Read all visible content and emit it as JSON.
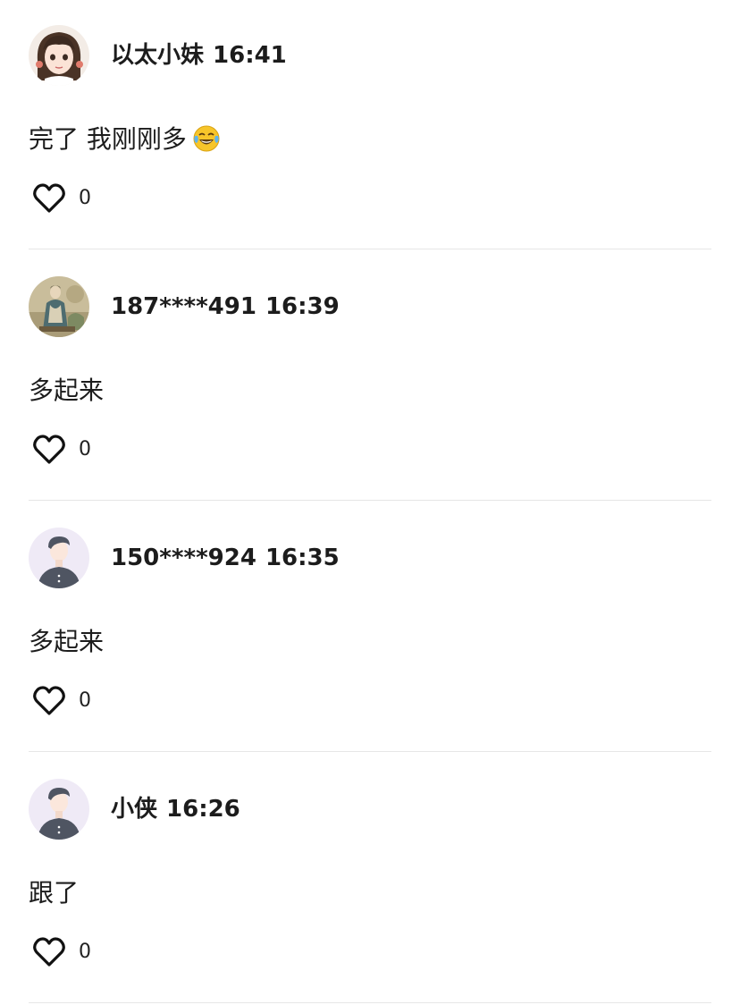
{
  "comments": [
    {
      "user": "以太小妹",
      "time": "16:41",
      "text": "完了 我刚刚多",
      "emoji": "tears-of-joy-emoji",
      "likes": "0",
      "avatar": "anime-girl-avatar"
    },
    {
      "user": "187****491",
      "time": "16:39",
      "text": "多起来",
      "likes": "0",
      "avatar": "painting-avatar"
    },
    {
      "user": "150****924",
      "time": "16:35",
      "text": "多起来",
      "likes": "0",
      "avatar": "default-user-avatar"
    },
    {
      "user": "小侠",
      "time": "16:26",
      "text": "跟了",
      "likes": "0",
      "avatar": "default-user-avatar"
    }
  ],
  "colors": {
    "text": "#1c1c1c",
    "divider": "#e6e6e6",
    "default_avatar_bg": "#efeaf6",
    "default_avatar_figure": "#4f5562"
  }
}
